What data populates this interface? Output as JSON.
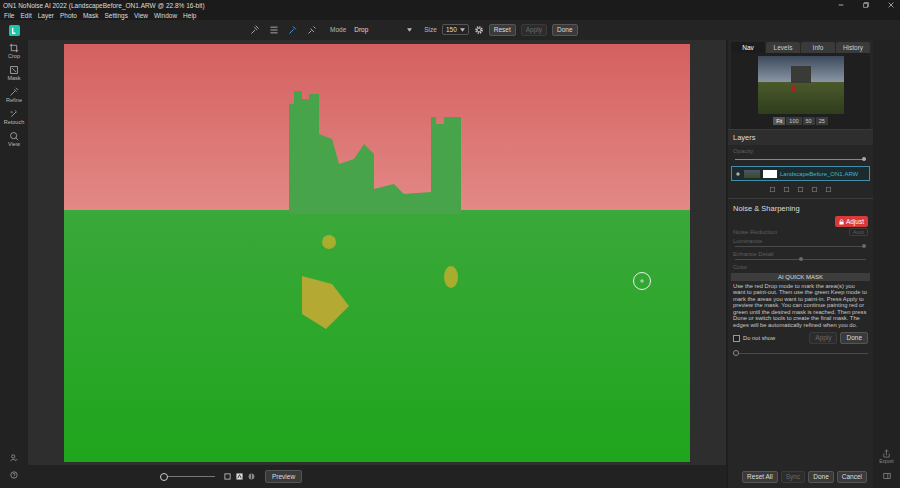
{
  "window": {
    "title": "ON1 NoNoise AI 2022 (LandscapeBefore_ON1.ARW @ 22.8% 16-bit)"
  },
  "menu": [
    "File",
    "Edit",
    "Layer",
    "Photo",
    "Mask",
    "Settings",
    "View",
    "Window",
    "Help"
  ],
  "toolbar": {
    "brush_tools": [
      {
        "selected": false
      },
      {
        "selected": false
      },
      {
        "selected": true
      },
      {
        "selected": false
      }
    ],
    "mode_label": "Mode",
    "mode_value": "Drop",
    "size_label": "Size",
    "size_value": "150",
    "buttons": [
      {
        "label": "Reset",
        "disabled": false
      },
      {
        "label": "Apply",
        "disabled": true
      },
      {
        "label": "Done",
        "disabled": false
      }
    ]
  },
  "tools": [
    {
      "label": "Crop"
    },
    {
      "label": "Mask"
    },
    {
      "label": "Refine"
    },
    {
      "label": "Retouch"
    },
    {
      "label": "View"
    }
  ],
  "bottom_bar": {
    "zoom_level": 0.07,
    "preview": "Preview",
    "buttons": [
      {
        "label": "Reset All",
        "disabled": false
      },
      {
        "label": "Sync",
        "disabled": true
      },
      {
        "label": "Done",
        "disabled": false
      },
      {
        "label": "Cancel",
        "disabled": false
      }
    ]
  },
  "right_panel": {
    "tabs": [
      {
        "label": "Nav",
        "selected": true
      },
      {
        "label": "Levels",
        "selected": false
      },
      {
        "label": "Info",
        "selected": false
      },
      {
        "label": "History",
        "selected": false
      }
    ],
    "zoom_buttons": [
      {
        "label": "Fit",
        "selected": true
      },
      {
        "label": "100",
        "selected": false
      },
      {
        "label": "50",
        "selected": false
      },
      {
        "label": "25",
        "selected": false
      }
    ],
    "layers": {
      "title": "Layers",
      "opacity_label": "Opacity",
      "opacity_level": 1,
      "items": [
        {
          "name": "LandscapeBefore_ON1.ARW",
          "selected": true,
          "visible": true
        }
      ]
    },
    "noise": {
      "title": "Noise & Sharpening",
      "adjust": "Adjust",
      "rows": [
        {
          "kind": "heading",
          "label": "Noise Reduction",
          "button": "Auto"
        },
        {
          "kind": "slider",
          "label": "Luminance",
          "level": 1
        },
        {
          "kind": "slider",
          "label": "Enhance Detail",
          "level": 0.52
        },
        {
          "kind": "label",
          "label": "Color"
        }
      ]
    },
    "quick_mask": {
      "title": "AI QUICK MASK",
      "text": "Use the red Drop mode to mark the area(s) you want to paint-out. Then use the green Keep mode to mark the areas you want to paint-in. Press Apply to preview the mask. You can continue painting red or green until the desired mask is reached. Then press Done or switch tools to create the final mask. The edges will be automatically refined when you do.",
      "do_not_show": {
        "label": "Do not show",
        "checked": false
      },
      "buttons": [
        {
          "label": "Apply",
          "disabled": true
        },
        {
          "label": "Done",
          "disabled": false
        }
      ]
    },
    "sharpening_level": 0
  },
  "export": {
    "label": "Export"
  }
}
